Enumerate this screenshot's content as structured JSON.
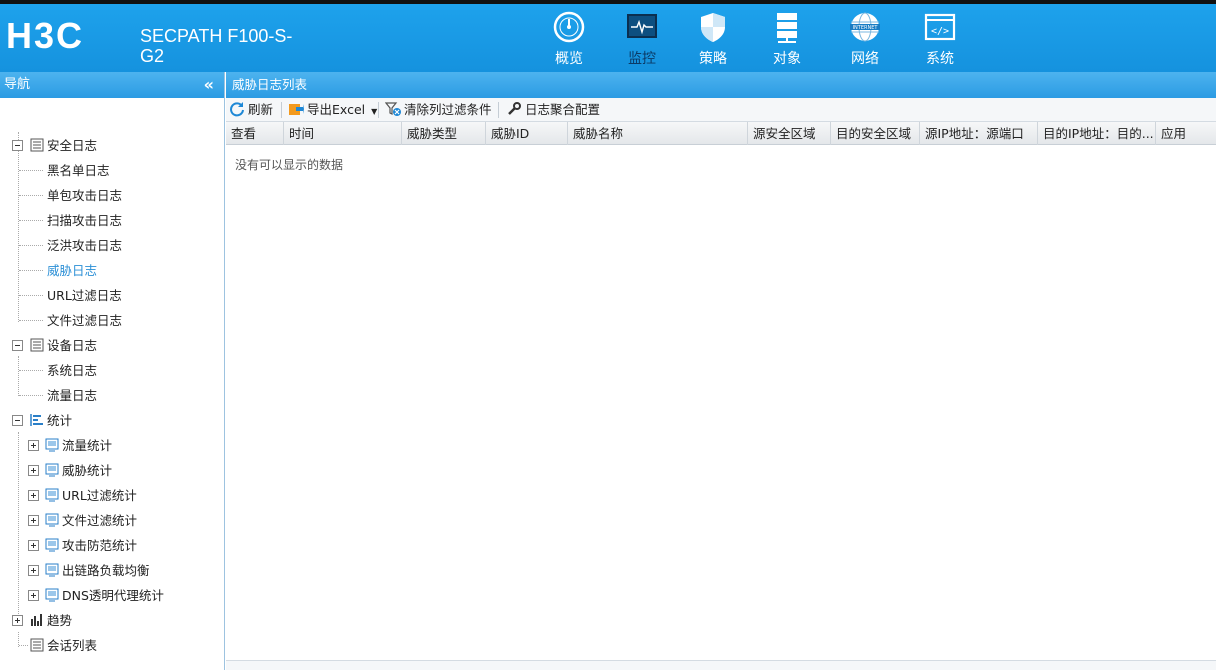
{
  "header": {
    "product_line1": "SECPATH F100-S-",
    "product_line2": "G2",
    "nav": [
      {
        "label": "概览",
        "icon": "dashboard-icon"
      },
      {
        "label": "监控",
        "icon": "monitor-icon"
      },
      {
        "label": "策略",
        "icon": "shield-icon"
      },
      {
        "label": "对象",
        "icon": "server-icon"
      },
      {
        "label": "网络",
        "icon": "internet-globe-icon"
      },
      {
        "label": "系统",
        "icon": "code-window-icon"
      }
    ],
    "logo_text": "H3C"
  },
  "sidebar": {
    "title": "导航",
    "collapse": "«",
    "items": [
      {
        "label": "安全日志"
      },
      {
        "label": "黑名单日志"
      },
      {
        "label": "单包攻击日志"
      },
      {
        "label": "扫描攻击日志"
      },
      {
        "label": "泛洪攻击日志"
      },
      {
        "label": "威胁日志"
      },
      {
        "label": "URL过滤日志"
      },
      {
        "label": "文件过滤日志"
      },
      {
        "label": "设备日志"
      },
      {
        "label": "系统日志"
      },
      {
        "label": "流量日志"
      },
      {
        "label": "统计"
      },
      {
        "label": "流量统计"
      },
      {
        "label": "威胁统计"
      },
      {
        "label": "URL过滤统计"
      },
      {
        "label": "文件过滤统计"
      },
      {
        "label": "攻击防范统计"
      },
      {
        "label": "出链路负载均衡"
      },
      {
        "label": "DNS透明代理统计"
      },
      {
        "label": "趋势"
      },
      {
        "label": "会话列表"
      }
    ]
  },
  "main": {
    "title": "威胁日志列表",
    "toolbar": {
      "refresh": "刷新",
      "export": "导出Excel",
      "clear_filter": "清除列过滤条件",
      "aggregate": "日志聚合配置"
    },
    "columns": [
      "查看",
      "时间",
      "威胁类型",
      "威胁ID",
      "威胁名称",
      "源安全区域",
      "目的安全区域",
      "源IP地址：源端口",
      "目的IP地址：目的...",
      "应用"
    ],
    "empty_text": "没有可以显示的数据"
  }
}
